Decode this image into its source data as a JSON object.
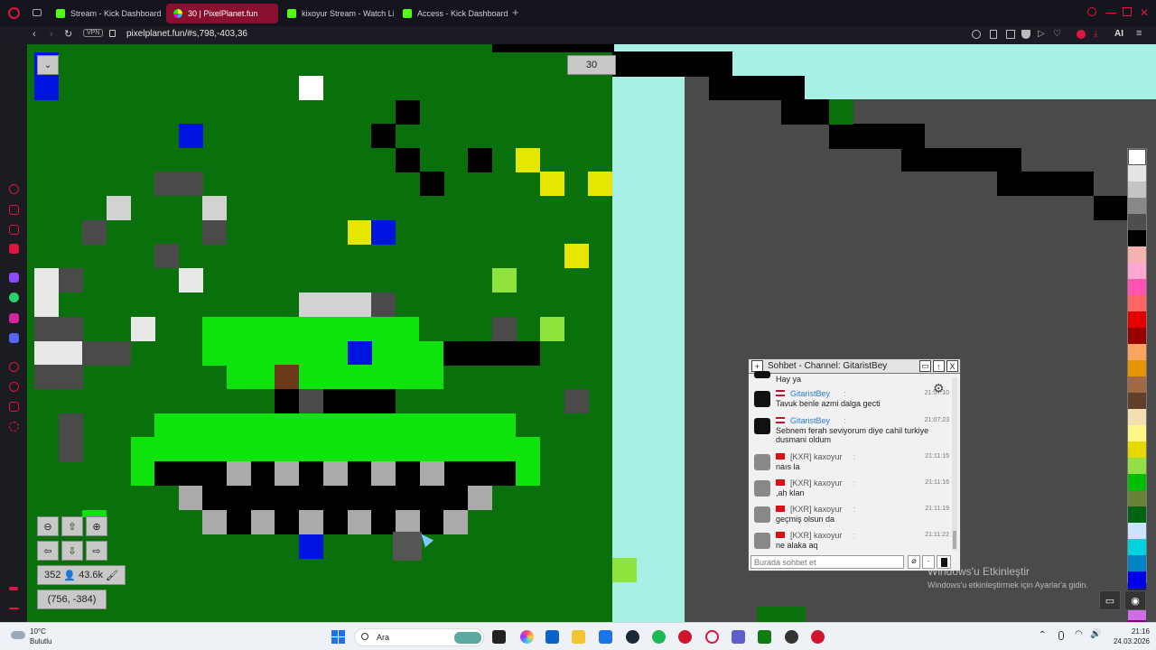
{
  "browser": {
    "tabs": [
      {
        "label": "Stream - Kick Dashboard",
        "icon": "kick-icon",
        "active": false
      },
      {
        "label": "30 | PixelPlanet.fun",
        "icon": "pixelplanet-icon",
        "active": true
      },
      {
        "label": "kixoyur Stream - Watch Li",
        "icon": "kick-icon",
        "active": false
      },
      {
        "label": "Access - Kick Dashboard",
        "icon": "kick-icon",
        "active": false
      }
    ],
    "new_tab": "+",
    "url": "pixelplanet.fun/#s,798,-403,36",
    "vpn_label": "VPN",
    "ai_label": "AI"
  },
  "pixelplanet": {
    "online_indicator": "30",
    "stats": {
      "online": "352",
      "pixels": "43.6k"
    },
    "coordinates": "(756, -384)"
  },
  "chat": {
    "title": "Sohbet - Channel: GitaristBey",
    "input_placeholder": "Burada sohbet et",
    "messages": [
      {
        "user": "",
        "time": "",
        "text": "Hay ya"
      },
      {
        "user": "GitaristBey",
        "time": "21:07:10",
        "text": "Tavuk benle azmi dalga gecti"
      },
      {
        "user": "GitaristBey",
        "time": "21:07:23",
        "text": "Sebnem ferah seviyorum diye cahil turkiye dusmani oldum"
      },
      {
        "user": "[KXR] kaxoyur",
        "time": "21:11:15",
        "text": "naıs la"
      },
      {
        "user": "[KXR] kaxoyur",
        "time": "21:11:16",
        "text": ",ah klan"
      },
      {
        "user": "[KXR] kaxoyur",
        "time": "21:11:19",
        "text": "geçmiş olsun da"
      },
      {
        "user": "[KXR] kaxoyur",
        "time": "21:11:22",
        "text": "ne alaka aq"
      }
    ]
  },
  "watermark": {
    "line1": "Windows'u Etkinleştir",
    "line2": "Windows'u etkinleştirmek için Ayarlar'a gidin."
  },
  "taskbar": {
    "weather_temp": "10°C",
    "weather_desc": "Bulutlu",
    "search_label": "Ara",
    "time": "21:16",
    "date": "24.03.2026"
  },
  "colors": {
    "canvas_green": "#0a700b",
    "bright_green": "#0ee30e",
    "sky": "#a8f0e6",
    "gray": "#4a4a4a",
    "tab_active": "#8a0f2f"
  },
  "palette": [
    "#ffffff",
    "#e4e4e4",
    "#c4c4c4",
    "#888888",
    "#4e4e4e",
    "#000000",
    "#f4b3ae",
    "#ffa7d1",
    "#ff54b2",
    "#ff6565",
    "#e50000",
    "#9a0000",
    "#fea460",
    "#e59500",
    "#a06a42",
    "#604028",
    "#f5dfb0",
    "#fff889",
    "#e5d900",
    "#94e044",
    "#02be01",
    "#688338",
    "#006513",
    "#cae3ff",
    "#00d3dd",
    "#0083c7",
    "#0000ea",
    "#191973",
    "#cf6ee4",
    "#820080"
  ]
}
